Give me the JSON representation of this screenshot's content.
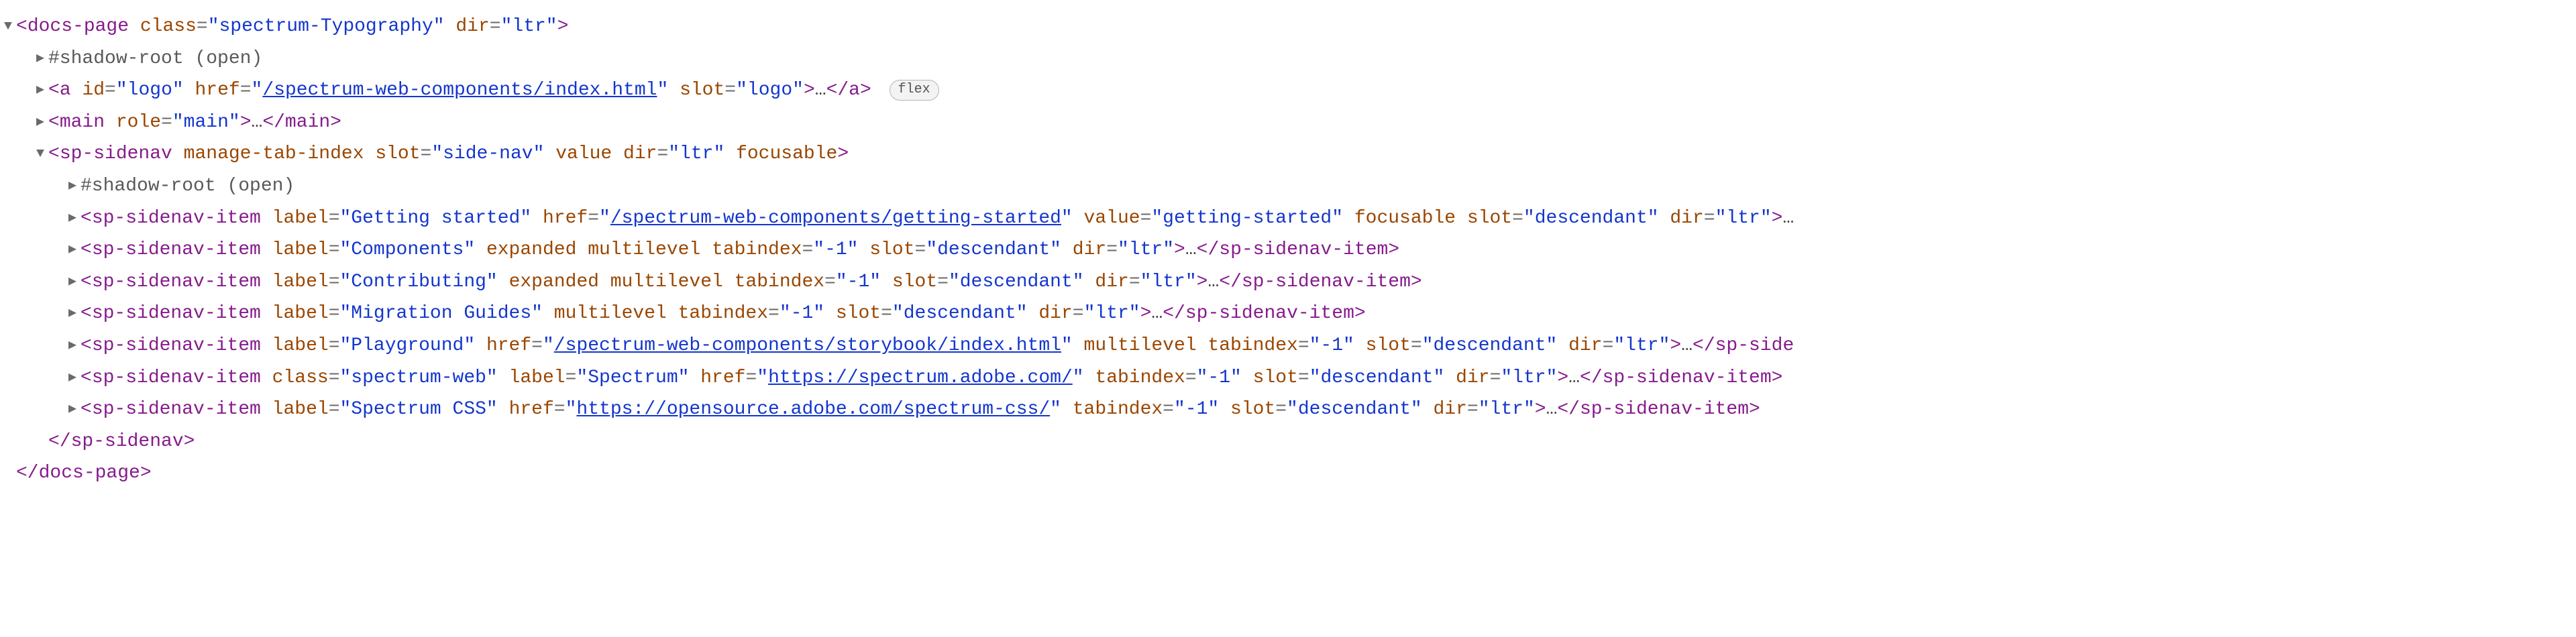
{
  "badges": {
    "flex": "flex"
  },
  "shadow_root": "#shadow-root (open)",
  "ellipsis": "…",
  "docs_page": {
    "name": "docs-page",
    "attrs": {
      "class_k": "class",
      "class_v": "\"spectrum-Typography\"",
      "dir_k": "dir",
      "dir_v": "\"ltr\""
    },
    "close": "</docs-page>"
  },
  "anchor": {
    "name": "a",
    "attrs": {
      "id_k": "id",
      "id_v": "\"logo\"",
      "href_k": "href",
      "href_q": "\"",
      "href_link": "/spectrum-web-components/index.html",
      "slot_k": "slot",
      "slot_v": "\"logo\""
    },
    "close": "</a>"
  },
  "main": {
    "name": "main",
    "attrs": {
      "role_k": "role",
      "role_v": "\"main\""
    },
    "close": "</main>"
  },
  "sidenav": {
    "name": "sp-sidenav",
    "attrs": {
      "manage_tab": "manage-tab-index",
      "slot_k": "slot",
      "slot_v": "\"side-nav\"",
      "value_k": "value",
      "dir_k": "dir",
      "dir_v": "\"ltr\"",
      "focusable": "focusable"
    },
    "close": "</sp-sidenav>"
  },
  "item_common": {
    "name": "sp-sidenav-item",
    "close": "</sp-sidenav-item>",
    "close_trunc": "</sp-side",
    "label_k": "label",
    "href_k": "href",
    "href_q": "\"",
    "value_k": "value",
    "slot_k": "slot",
    "slot_v": "\"descendant\"",
    "dir_k": "dir",
    "dir_v": "\"ltr\"",
    "class_k": "class",
    "tabindex_k": "tabindex",
    "tabindex_v": "\"-1\"",
    "expanded": "expanded",
    "multilevel": "multilevel",
    "focusable": "focusable"
  },
  "items": {
    "getting_started": {
      "label_v": "\"Getting started\"",
      "href_link": "/spectrum-web-components/getting-started",
      "value_v": "\"getting-started\""
    },
    "components": {
      "label_v": "\"Components\""
    },
    "contributing": {
      "label_v": "\"Contributing\""
    },
    "migration": {
      "label_v": "\"Migration Guides\""
    },
    "playground": {
      "label_v": "\"Playground\"",
      "href_link": "/spectrum-web-components/storybook/index.html"
    },
    "spectrum": {
      "label_v": "\"Spectrum\"",
      "class_v": "\"spectrum-web\"",
      "href_link": "https://spectrum.adobe.com/"
    },
    "spectrum_css": {
      "label_v": "\"Spectrum CSS\"",
      "href_link": "https://opensource.adobe.com/spectrum-css/"
    }
  }
}
